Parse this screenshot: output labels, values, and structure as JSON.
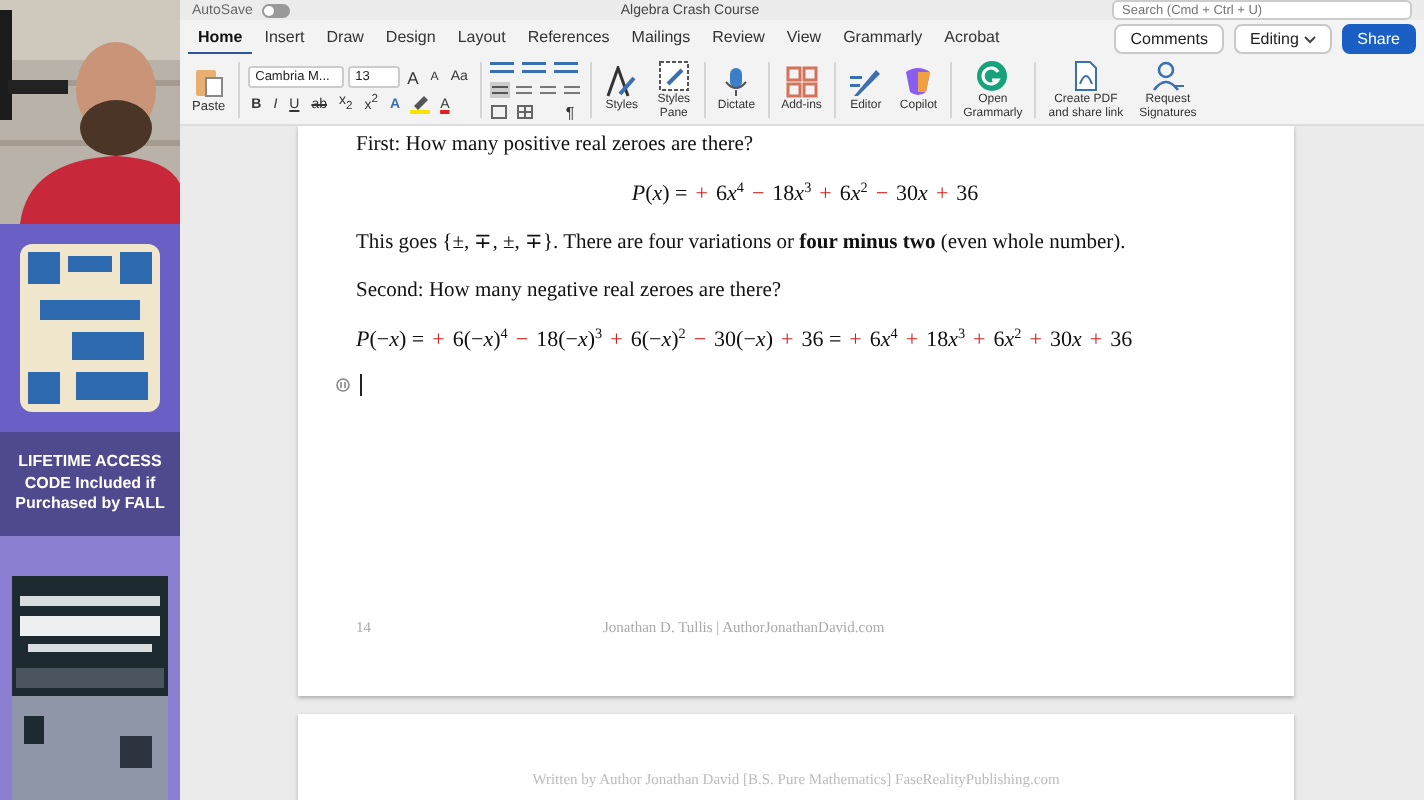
{
  "title_bar": {
    "autosave": "AutoSave",
    "autosave_on": false,
    "title": "Algebra Crash Course",
    "search": {
      "placeholder": "Search (Cmd + Ctrl + U)"
    }
  },
  "tabs": [
    {
      "label": "Home",
      "selected": true
    },
    {
      "label": "Insert",
      "selected": false
    },
    {
      "label": "Draw",
      "selected": false
    },
    {
      "label": "Design",
      "selected": false
    },
    {
      "label": "Layout",
      "selected": false
    },
    {
      "label": "References",
      "selected": false
    },
    {
      "label": "Mailings",
      "selected": false
    },
    {
      "label": "Review",
      "selected": false
    },
    {
      "label": "View",
      "selected": false
    },
    {
      "label": "Grammarly",
      "selected": false
    },
    {
      "label": "Acrobat",
      "selected": false
    }
  ],
  "actions": [
    {
      "label": "Comments",
      "kind": "comments"
    },
    {
      "label": "Editing",
      "kind": "editing"
    },
    {
      "label": "Share",
      "kind": "share"
    }
  ],
  "ribbon": {
    "paste": "Paste",
    "font_name": "Cambria M...",
    "font_size": "13",
    "font_tools": [
      {
        "kind": "grow",
        "label": "A"
      },
      {
        "kind": "shrink",
        "label": "A"
      },
      {
        "kind": "case",
        "label": "Aa"
      }
    ],
    "format_buttons": [
      {
        "kind": "bold",
        "label": "B"
      },
      {
        "kind": "italic",
        "label": "I"
      },
      {
        "kind": "underline",
        "label": "U"
      },
      {
        "kind": "strike",
        "label": "ab"
      },
      {
        "kind": "sub",
        "label": "x$_{2}$"
      },
      {
        "kind": "sup",
        "label": "x$^{2}$"
      },
      {
        "kind": "effects",
        "label": "A"
      },
      {
        "kind": "color",
        "label": "A"
      }
    ],
    "pilcrow": "¶",
    "tools": [
      {
        "kind": "styles",
        "label": "Styles"
      },
      {
        "kind": "styles_pane",
        "label": "Styles\nPane"
      },
      {
        "kind": "dictate",
        "label": "Dictate"
      },
      {
        "kind": "addins",
        "label": "Add-ins"
      },
      {
        "kind": "editor",
        "label": "Editor"
      },
      {
        "kind": "copilot",
        "label": "Copilot"
      },
      {
        "kind": "grammarly",
        "label": "Open\nGrammarly"
      },
      {
        "kind": "pdf",
        "label": "Create PDF\nand share link"
      },
      {
        "kind": "signatures",
        "label": "Request\nSignatures"
      }
    ]
  },
  "side_panel": {
    "promo": "LIFETIME ACCESS CODE Included if Purchased by FALL"
  },
  "document": {
    "paragraphs": [
      {
        "kind": "text",
        "text": "First: How many positive real zeroes are there?"
      },
      {
        "kind": "equation",
        "centered": true,
        "parts": [
          {
            "kind": "term",
            "text": "*P*(*x*) ="
          },
          {
            "kind": "sign",
            "text": "+"
          },
          {
            "kind": "term",
            "text": "6"
          },
          {
            "kind": "term",
            "text": "*x*$^{4}$"
          },
          {
            "kind": "sign",
            "text": "−"
          },
          {
            "kind": "term",
            "text": "18"
          },
          {
            "kind": "term",
            "text": "*x*$^{3}$"
          },
          {
            "kind": "sign",
            "text": "+"
          },
          {
            "kind": "term",
            "text": "6"
          },
          {
            "kind": "term",
            "text": "*x*$^{2}$"
          },
          {
            "kind": "sign",
            "text": "−"
          },
          {
            "kind": "term",
            "text": "30"
          },
          {
            "kind": "term",
            "text": "*x*"
          },
          {
            "kind": "sign",
            "text": "+"
          },
          {
            "kind": "term",
            "text": "36"
          }
        ]
      },
      {
        "kind": "text",
        "text": "This goes {±, ∓, ±, ∓}. There are four variations or **four minus two** (even whole number)."
      },
      {
        "kind": "text",
        "text": "Second: How many negative real zeroes are there?"
      },
      {
        "kind": "equation",
        "centered": false,
        "parts": [
          {
            "kind": "term",
            "text": "*P*(−*x*) ="
          },
          {
            "kind": "sign",
            "text": "+"
          },
          {
            "kind": "term",
            "text": "6(−*x*)$^{4}$"
          },
          {
            "kind": "sign",
            "text": "−"
          },
          {
            "kind": "term",
            "text": "18(−*x*)$^{3}$"
          },
          {
            "kind": "sign",
            "text": "+"
          },
          {
            "kind": "term",
            "text": "6(−*x*)$^{2}$"
          },
          {
            "kind": "sign",
            "text": "−"
          },
          {
            "kind": "term",
            "text": "30(−*x*)"
          },
          {
            "kind": "sign",
            "text": "+"
          },
          {
            "kind": "term",
            "text": "36 ="
          },
          {
            "kind": "sign",
            "text": "+"
          },
          {
            "kind": "term",
            "text": "6"
          },
          {
            "kind": "term",
            "text": "*x*$^{4}$"
          },
          {
            "kind": "sign",
            "text": "+"
          },
          {
            "kind": "term",
            "text": "18"
          },
          {
            "kind": "term",
            "text": "*x*$^{3}$"
          },
          {
            "kind": "sign",
            "text": "+"
          },
          {
            "kind": "term",
            "text": "6"
          },
          {
            "kind": "term",
            "text": "*x*$^{2}$"
          },
          {
            "kind": "sign",
            "text": "+"
          },
          {
            "kind": "term",
            "text": "30"
          },
          {
            "kind": "term",
            "text": "*x*"
          },
          {
            "kind": "sign",
            "text": "+"
          },
          {
            "kind": "term",
            "text": "36"
          }
        ]
      },
      {
        "kind": "cursor"
      }
    ],
    "page_number": "14",
    "footer": "Jonathan D. Tullis | AuthorJonathanDavid.com",
    "next_header": "Written by Author Jonathan David [B.S. Pure Mathematics] FaseRealityPublishing.com"
  }
}
